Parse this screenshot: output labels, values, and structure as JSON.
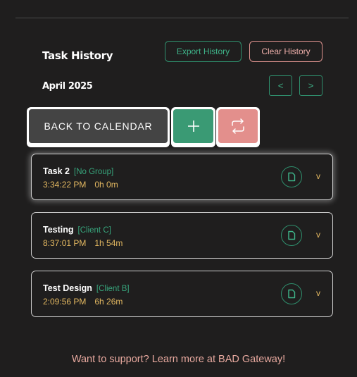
{
  "header": {
    "title": "Task History",
    "export_label": "Export History",
    "clear_label": "Clear History"
  },
  "calendar": {
    "month": "April 2025",
    "prev_label": "<",
    "next_label": ">"
  },
  "actions": {
    "back_label": "BACK TO CALENDAR",
    "add_icon": "plus-icon",
    "swap_icon": "repeat-icon"
  },
  "tasks": [
    {
      "name": "Task 2",
      "group": "[No Group]",
      "time": "3:34:22 PM",
      "duration": "0h 0m",
      "expand": "v"
    },
    {
      "name": "Testing",
      "group": "[Client C]",
      "time": "8:37:01 PM",
      "duration": "1h 54m",
      "expand": "v"
    },
    {
      "name": "Test Design",
      "group": "[Client B]",
      "time": "2:09:56 PM",
      "duration": "6h 26m",
      "expand": "v"
    }
  ],
  "footer": {
    "text": "Want to support? Learn more at BAD Gateway!"
  },
  "colors": {
    "accent_green": "#3fb58a",
    "accent_red": "#e38f8c",
    "time_yellow": "#e3b861",
    "background": "#1f1e1e"
  }
}
